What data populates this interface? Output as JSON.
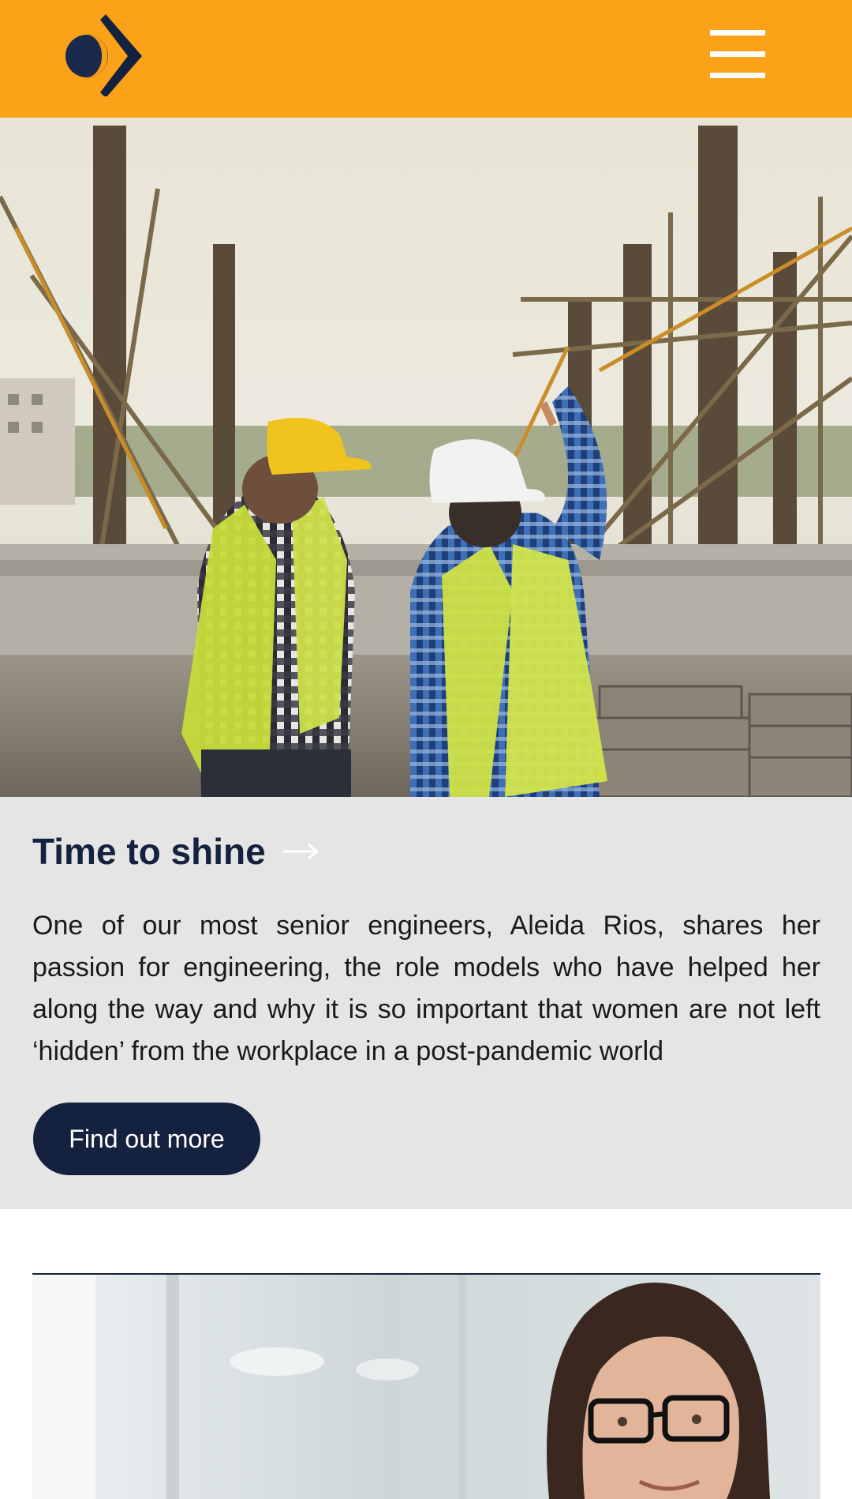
{
  "brand": {
    "logo_icon": "brand-logo-icon",
    "primary_color": "#fba219",
    "dark_color": "#15223f",
    "accent_color": "#f5a01a"
  },
  "header": {
    "menu_icon": "hamburger-menu-icon"
  },
  "hero": {
    "image": "construction-engineers-photo"
  },
  "card": {
    "title": "Time to shine",
    "title_icon": "arrow-right-icon",
    "body": "One of our most senior engineers, Aleida Rios, shares her passion for engineering, the role models who have helped her along the way and why it is so important that women are not left ‘hidden’ from the workplace in a post-pandemic world",
    "button_label": "Find out more",
    "background": "#e5e5e5"
  },
  "next_card": {
    "image": "woman-with-glasses-photo"
  }
}
